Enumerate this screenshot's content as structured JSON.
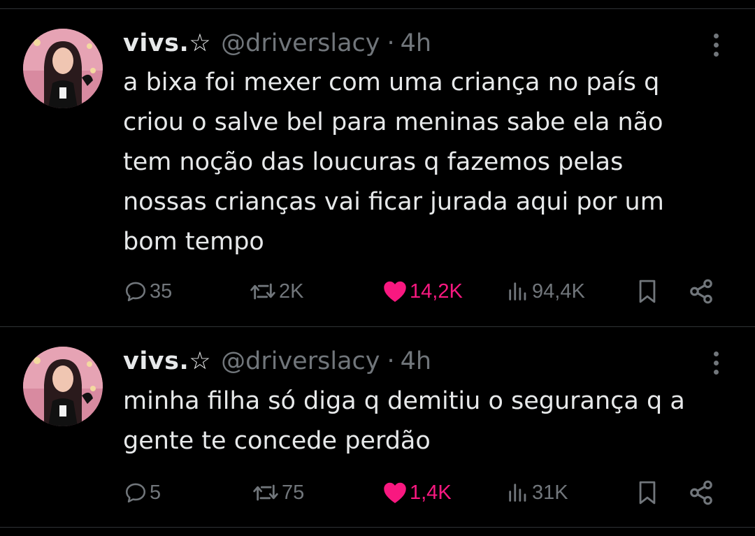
{
  "tweets": [
    {
      "display_name": "vivs.☆",
      "handle": "@driverslacy",
      "separator": "·",
      "time": "4h",
      "text": "a bixa foi mexer com uma criança no país q\ncriou o salve bel para meninas sabe ela não\ntem noção das loucuras q fazemos pelas\nnossas crianças vai ficar jurada aqui por um\nbom tempo",
      "replies": "35",
      "retweets": "2K",
      "likes": "14,2K",
      "liked": true,
      "views": "94,4K"
    },
    {
      "display_name": "vivs.☆",
      "handle": "@driverslacy",
      "separator": "·",
      "time": "4h",
      "text": "minha filha só diga q demitiu o segurança q a\ngente te concede perdão",
      "replies": "5",
      "retweets": "75",
      "likes": "1,4K",
      "liked": true,
      "views": "31K"
    }
  ],
  "icons": {
    "reply": "reply-icon",
    "retweet": "retweet-icon",
    "like": "heart-icon",
    "views": "views-icon",
    "bookmark": "bookmark-icon",
    "share": "share-icon",
    "more": "more-dots-icon"
  },
  "colors": {
    "background": "#000000",
    "text": "#e7e9ea",
    "muted": "#71767b",
    "like": "#f91880",
    "divider": "#2f3336"
  }
}
